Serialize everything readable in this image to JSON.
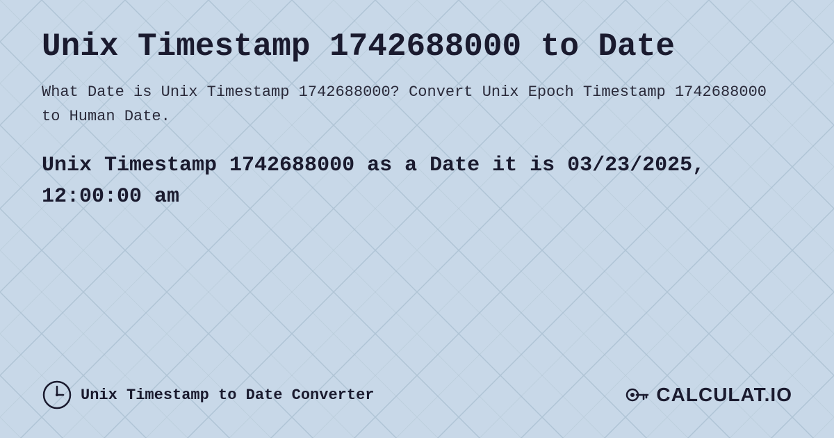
{
  "page": {
    "title": "Unix Timestamp 1742688000 to Date",
    "description": "What Date is Unix Timestamp 1742688000? Convert Unix Epoch Timestamp 1742688000 to Human Date.",
    "result": "Unix Timestamp 1742688000 as a Date it is 03/23/2025, 12:00:00 am",
    "footer_link": "Unix Timestamp to Date Converter",
    "logo_text": "CALCULAT.IO",
    "background_color": "#c8d8e8"
  }
}
